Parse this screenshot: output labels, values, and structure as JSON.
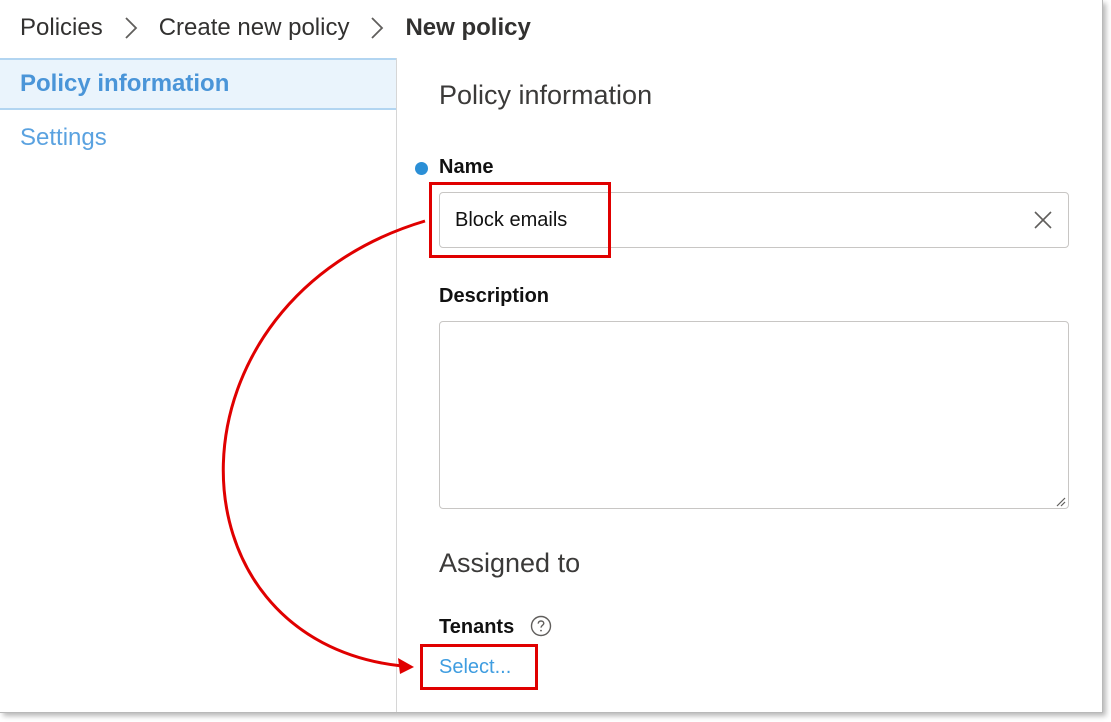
{
  "breadcrumb": {
    "items": [
      "Policies",
      "Create new policy"
    ],
    "current": "New policy"
  },
  "sidebar": {
    "items": [
      {
        "label": "Policy information",
        "active": true
      },
      {
        "label": "Settings",
        "active": false
      }
    ]
  },
  "main": {
    "section_title": "Policy information",
    "name": {
      "label": "Name",
      "required": true,
      "value": "Block emails"
    },
    "description": {
      "label": "Description",
      "value": ""
    },
    "assigned_section_title": "Assigned to",
    "tenants": {
      "label": "Tenants",
      "select_link": "Select..."
    }
  },
  "icons": {
    "breadcrumb_separator": "chevron-right-icon",
    "clear": "close-icon",
    "help": "question-circle-icon",
    "resize": "resize-grip-icon"
  },
  "colors": {
    "accent": "#2b8fd6",
    "link": "#3f9de0",
    "active_nav_bg": "#eaf4fc",
    "annotation": "#e00000"
  }
}
